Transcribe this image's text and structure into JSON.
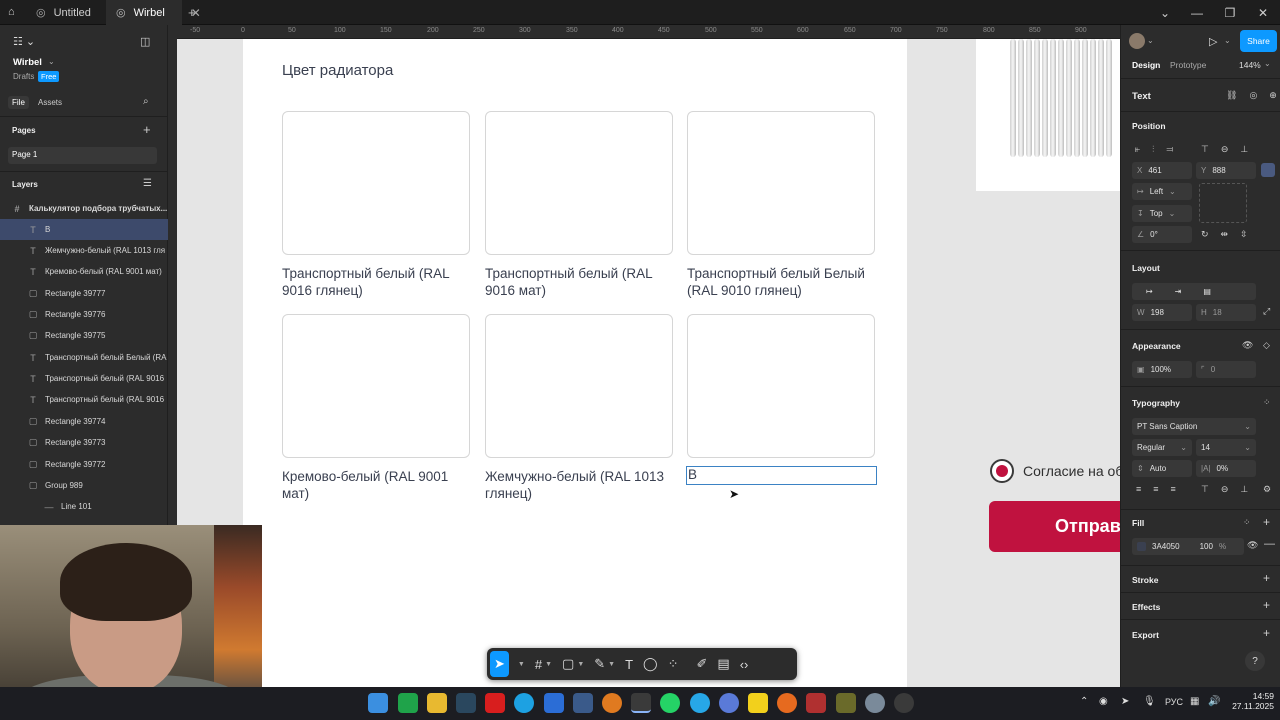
{
  "titlebar": {
    "tabs": [
      {
        "label": "Untitled"
      },
      {
        "label": "Wirbel"
      }
    ]
  },
  "left_panel": {
    "file_name": "Wirbel",
    "drafts_label": "Drafts",
    "plan_badge": "Free",
    "tab_file": "File",
    "tab_assets": "Assets",
    "pages_header": "Pages",
    "page_item": "Page 1",
    "layers_header": "Layers",
    "layers": [
      {
        "icon": "#",
        "label": "Калькулятор подбора трубчатых..."
      },
      {
        "icon": "T",
        "label": "В"
      },
      {
        "icon": "T",
        "label": "Жемчужно-белый (RAL 1013 гля"
      },
      {
        "icon": "T",
        "label": "Кремово-белый (RAL 9001 мат)"
      },
      {
        "icon": "▢",
        "label": "Rectangle 39777"
      },
      {
        "icon": "▢",
        "label": "Rectangle 39776"
      },
      {
        "icon": "▢",
        "label": "Rectangle 39775"
      },
      {
        "icon": "T",
        "label": "Транспортный белый Белый (RA"
      },
      {
        "icon": "T",
        "label": "Транспортный белый (RAL 9016"
      },
      {
        "icon": "T",
        "label": "Транспортный белый (RAL 9016"
      },
      {
        "icon": "▢",
        "label": "Rectangle 39774"
      },
      {
        "icon": "▢",
        "label": "Rectangle 39773"
      },
      {
        "icon": "▢",
        "label": "Rectangle 39772"
      },
      {
        "icon": "▢",
        "label": "Group 989"
      },
      {
        "icon": "—",
        "label": "Line 101"
      }
    ]
  },
  "ruler": {
    "ticks": [
      "-50",
      "0",
      "50",
      "100",
      "150",
      "200",
      "250",
      "300",
      "350",
      "400",
      "450",
      "500",
      "550",
      "600",
      "650",
      "700",
      "750",
      "800",
      "850",
      "900"
    ]
  },
  "canvas": {
    "frame_title": "Цвет радиатора",
    "cards": [
      {
        "label": "Транспортный белый (RAL 9016 глянец)"
      },
      {
        "label": "Транспортный белый (RAL 9016 мат)"
      },
      {
        "label": "Транспортный белый Белый (RAL 9010 глянец)"
      },
      {
        "label": "Кремово-белый (RAL 9001 мат)"
      },
      {
        "label": "Жемчужно-белый (RAL 1013 глянец)"
      }
    ],
    "editing_text": "В",
    "consent_text": "Согласие на об",
    "send_button": "Отправ"
  },
  "right_panel": {
    "tab_design": "Design",
    "tab_prototype": "Prototype",
    "zoom": "144%",
    "share": "Share",
    "selection_type": "Text",
    "position_header": "Position",
    "x_label": "X",
    "x_value": "461",
    "y_label": "Y",
    "y_value": "888",
    "h_constraint": "Left",
    "v_constraint": "Top",
    "rotation": "0°",
    "layout_header": "Layout",
    "w_label": "W",
    "w_value": "198",
    "h_label": "H",
    "h_value": "18",
    "appearance_header": "Appearance",
    "opacity": "100%",
    "radius": "0",
    "typography_header": "Typography",
    "font_family": "PT Sans Caption",
    "font_weight": "Regular",
    "font_size": "14",
    "line_height": "Auto",
    "letter_spacing": "0%",
    "fill_header": "Fill",
    "fill_hex": "3A4050",
    "fill_opacity": "100",
    "fill_pct": "%",
    "stroke_header": "Stroke",
    "effects_header": "Effects",
    "export_header": "Export"
  },
  "toolbar": {
    "tools": [
      "move-tool",
      "frame-tool",
      "rectangle-tool",
      "pen-tool",
      "text-tool",
      "comment-tool",
      "components-tool",
      "draw-mode",
      "dev-mode",
      "code-mode"
    ]
  },
  "taskbar": {
    "lang": "РУС",
    "time": "14:59",
    "date": "27.11.2025"
  },
  "colors": {
    "accent_blue": "#0d99ff",
    "brand_red": "#c0123f",
    "text_fill": "#3A4050"
  }
}
